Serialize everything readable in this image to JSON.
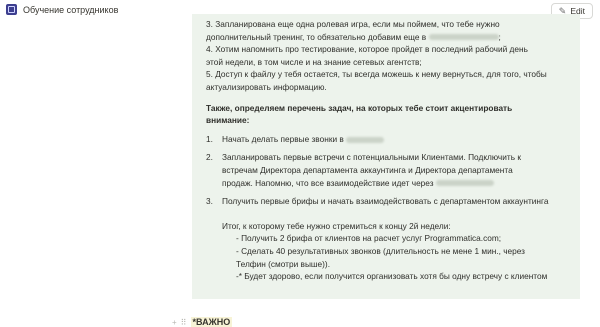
{
  "header": {
    "page_title": "Обучение сотрудников",
    "edit_label": "Edit",
    "icon": "pencil-icon"
  },
  "callout": {
    "lines_top": [
      "3. Запланирована еще одна ролевая игра, если мы поймем, что тебе нужно",
      "дополнительный тренинг, то обязательно добавим еще в",
      "4. Хотим напомнить про тестирование, которое пройдет в последний рабочий день",
      "этой недели, в том числе и на знание сетевых агентств;",
      "5. Доступ к файлу у тебя остается, ты всегда можешь к нему вернуться, для того, чтобы",
      "актуализировать информацию."
    ],
    "line2_suffix": ";",
    "heading_line1": "Также, определяем перечень задач, на которых тебе стоит акцентировать",
    "heading_line2": "внимание:",
    "tasks": [
      {
        "num": "1.",
        "lines": [
          "Начать делать первые звонки в"
        ]
      },
      {
        "num": "2.",
        "lines": [
          "Запланировать первые встречи с потенциальными Клиентами. Подключить к",
          "встречам Директора департамента аккаунтинга и Директора департамента",
          "продаж. Напомню, что все взаимодействие идет через"
        ]
      },
      {
        "num": "3.",
        "lines": [
          "Получить первые брифы и начать взаимодействовать с департаментом аккаунтинга"
        ]
      }
    ],
    "summary": [
      "Итог, к которому  тебе нужно стремиться к концу 2й недели:",
      "- Получить 2 брифа от клиентов на расчет услуг Programmatica.com;",
      "- Сделать 40 результативных звонков (длительность не мене 1 мин., через",
      "Телфин (смотри выше)).",
      "-* Будет здорово, если получится организовать хотя бы одну встречу с клиентом"
    ]
  },
  "bottom": {
    "add_icon": "plus-icon",
    "drag_icon": "drag-handle-icon",
    "label": "*ВАЖНО"
  }
}
